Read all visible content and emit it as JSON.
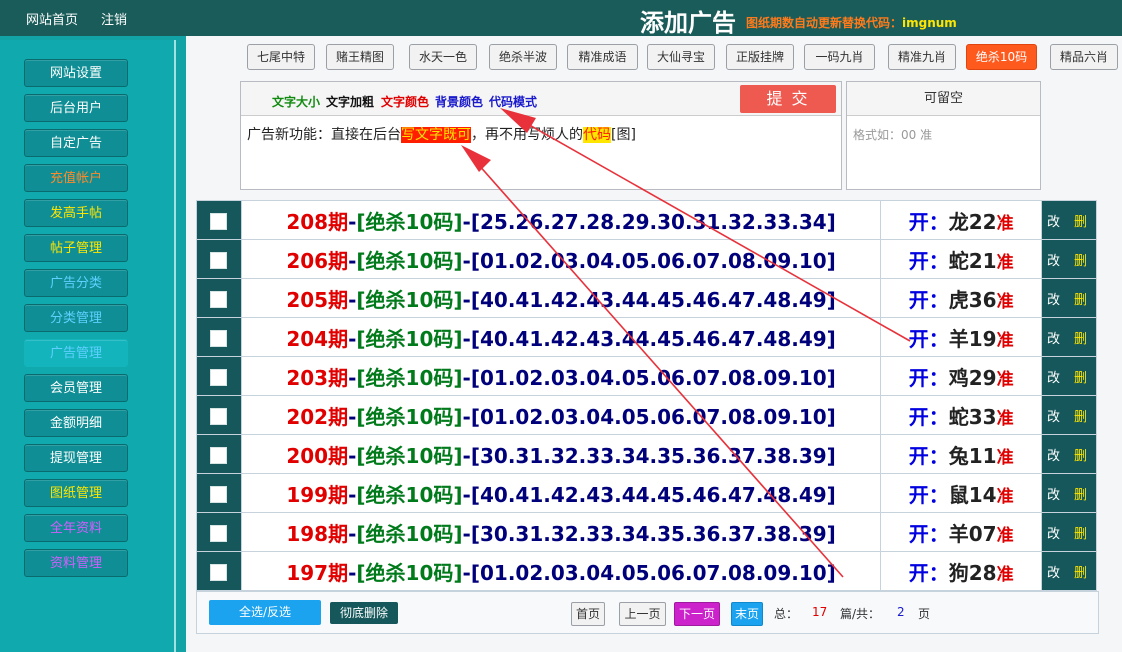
{
  "topbar": {
    "nav": [
      "网站首页",
      "注销"
    ],
    "title": "添加广告",
    "hint_prefix": "图纸期数自动更新替换代码：",
    "hint_code": "imgnum"
  },
  "sidebar": [
    {
      "label": "网站设置",
      "color": "#ffffff"
    },
    {
      "label": "后台用户",
      "color": "#ffffff"
    },
    {
      "label": "自定广告",
      "color": "#ffffff"
    },
    {
      "label": "充值帐户",
      "color": "#ff8a2a"
    },
    {
      "label": "发高手帖",
      "color": "#ffe600"
    },
    {
      "label": "帖子管理",
      "color": "#ffe600"
    },
    {
      "label": "广告分类",
      "color": "#5fd0ff"
    },
    {
      "label": "分类管理",
      "color": "#5fd0ff"
    },
    {
      "label": "广告管理",
      "color": "#5fd0ff"
    },
    {
      "label": "会员管理",
      "color": "#ffffff"
    },
    {
      "label": "金额明细",
      "color": "#ffffff"
    },
    {
      "label": "提现管理",
      "color": "#ffffff"
    },
    {
      "label": "图纸管理",
      "color": "#ffe600"
    },
    {
      "label": "全年资料",
      "color": "#d65cff"
    },
    {
      "label": "资料管理",
      "color": "#d65cff"
    }
  ],
  "category_tabs": [
    "七尾中特",
    "赌王精图",
    "水天一色",
    "绝杀半波",
    "精准成语",
    "大仙寻宝",
    "正版挂牌",
    "一码九肖",
    "精准九肖",
    "绝杀10码",
    "精品六肖"
  ],
  "active_tab": "绝杀10码",
  "editor": {
    "tool_size": "文字大小",
    "tool_bold": "文字加粗",
    "tool_color": "文字颜色",
    "tool_bg": "背景颜色",
    "tool_code": "代码模式",
    "submit": "提 交",
    "content_a": "广告新功能：直接在后台",
    "content_hl1": "写文字既可",
    "content_b": "，再不用写烦人的",
    "content_hl2": "代码",
    "content_c": "[图]"
  },
  "side_box": {
    "title": "可留空",
    "placeholder": "格式如：00 准"
  },
  "rows": [
    {
      "period": "208期",
      "cat": "[绝杀10码]",
      "nums": "[25.26.27.28.29.30.31.32.33.34]",
      "kai": "开：",
      "result": "龙22",
      "mark": "准"
    },
    {
      "period": "206期",
      "cat": "[绝杀10码]",
      "nums": "[01.02.03.04.05.06.07.08.09.10]",
      "kai": "开：",
      "result": "蛇21",
      "mark": "准"
    },
    {
      "period": "205期",
      "cat": "[绝杀10码]",
      "nums": "[40.41.42.43.44.45.46.47.48.49]",
      "kai": "开：",
      "result": "虎36",
      "mark": "准"
    },
    {
      "period": "204期",
      "cat": "[绝杀10码]",
      "nums": "[40.41.42.43.44.45.46.47.48.49]",
      "kai": "开：",
      "result": "羊19",
      "mark": "准"
    },
    {
      "period": "203期",
      "cat": "[绝杀10码]",
      "nums": "[01.02.03.04.05.06.07.08.09.10]",
      "kai": "开：",
      "result": "鸡29",
      "mark": "准"
    },
    {
      "period": "202期",
      "cat": "[绝杀10码]",
      "nums": "[01.02.03.04.05.06.07.08.09.10]",
      "kai": "开：",
      "result": "蛇33",
      "mark": "准"
    },
    {
      "period": "200期",
      "cat": "[绝杀10码]",
      "nums": "[30.31.32.33.34.35.36.37.38.39]",
      "kai": "开：",
      "result": "兔11",
      "mark": "准"
    },
    {
      "period": "199期",
      "cat": "[绝杀10码]",
      "nums": "[40.41.42.43.44.45.46.47.48.49]",
      "kai": "开：",
      "result": "鼠14",
      "mark": "准"
    },
    {
      "period": "198期",
      "cat": "[绝杀10码]",
      "nums": "[30.31.32.33.34.35.36.37.38.39]",
      "kai": "开：",
      "result": "羊07",
      "mark": "准"
    },
    {
      "period": "197期",
      "cat": "[绝杀10码]",
      "nums": "[01.02.03.04.05.06.07.08.09.10]",
      "kai": "开：",
      "result": "狗28",
      "mark": "准"
    }
  ],
  "row_actions": {
    "edit": "改",
    "delete": "删"
  },
  "footer": {
    "select_all": "全选/反选",
    "delete_all": "彻底删除",
    "first": "首页",
    "prev": "上一页",
    "next": "下一页",
    "last": "末页",
    "total_label": "总：",
    "total": "17",
    "pages_label": "篇/共：",
    "pages": "2",
    "page_unit": "页"
  }
}
